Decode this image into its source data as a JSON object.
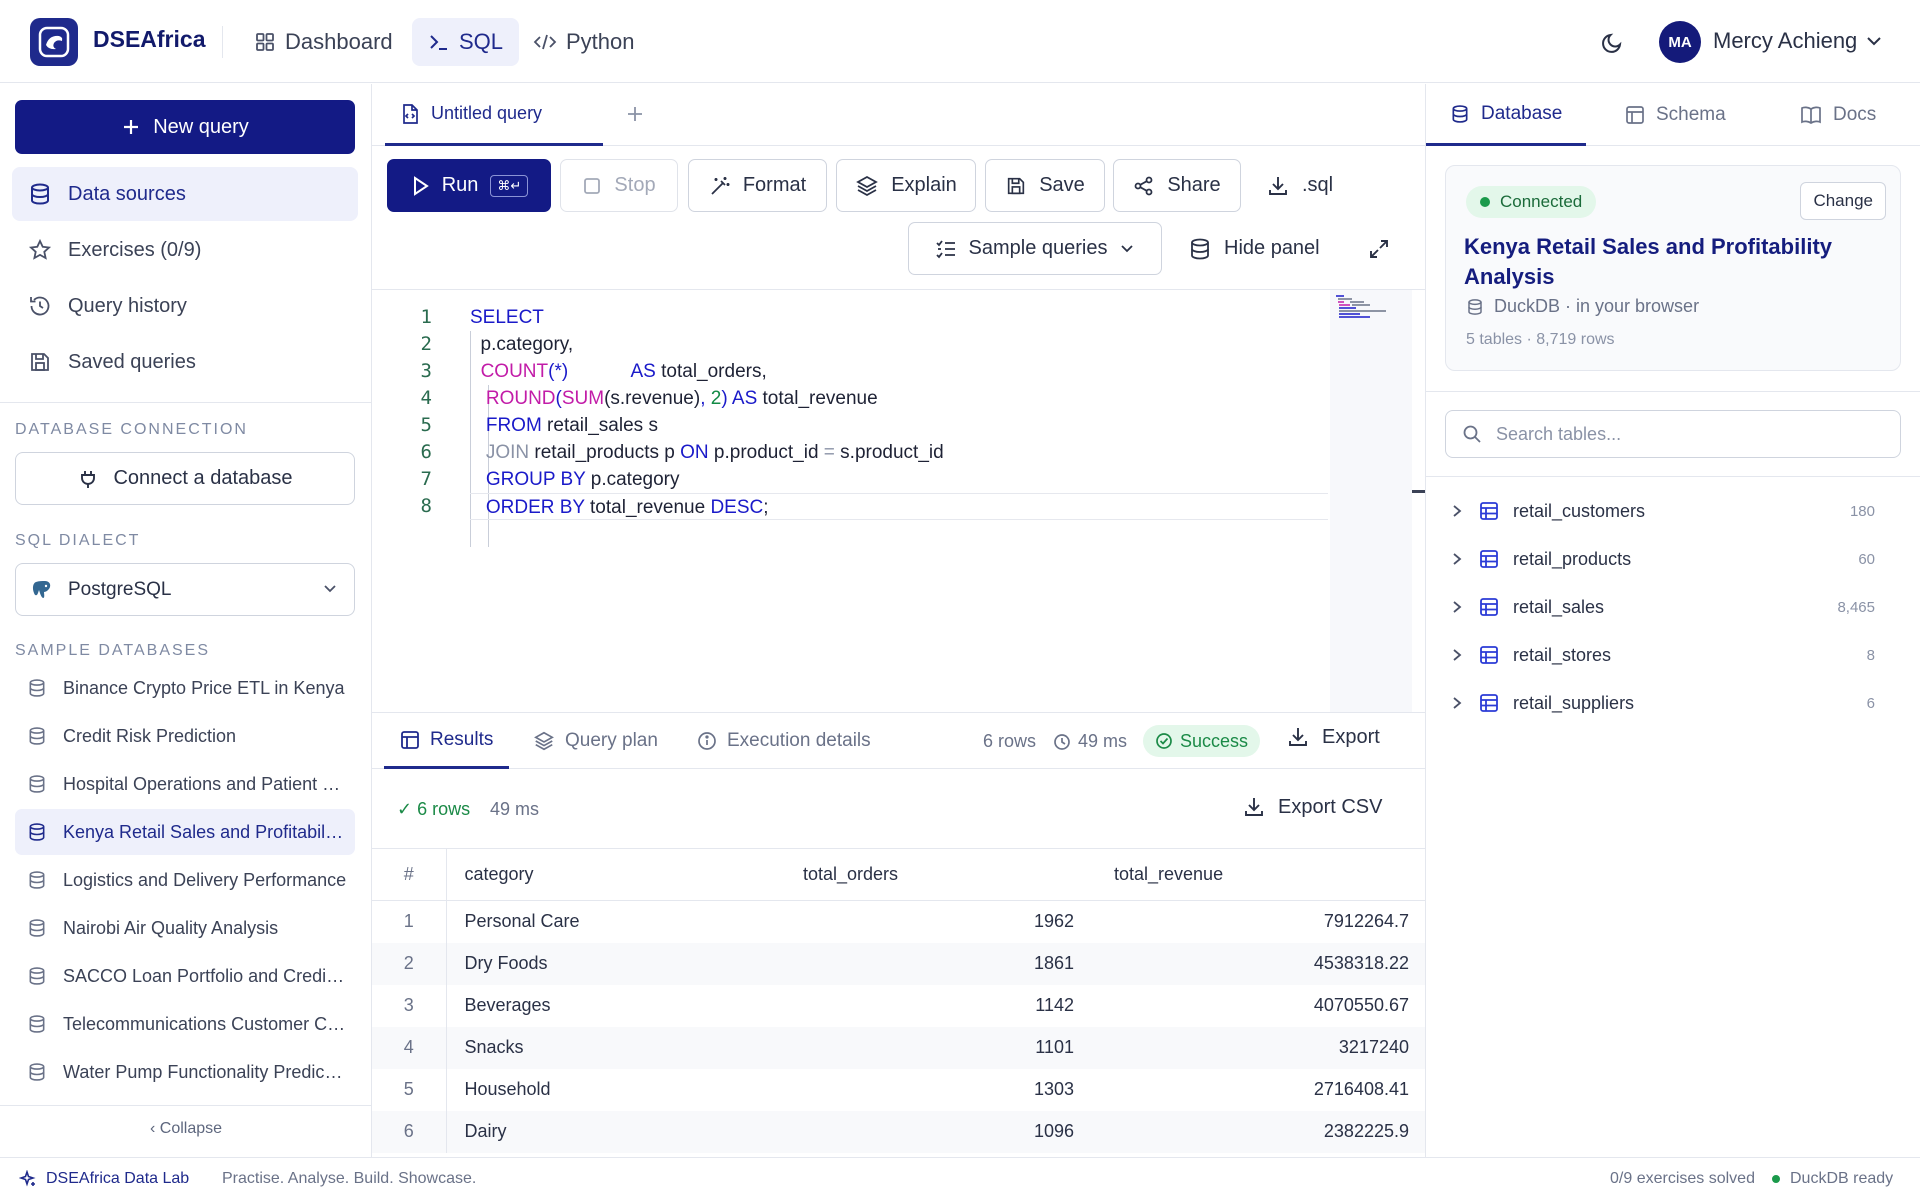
{
  "app": {
    "brand": "DSEAfrica",
    "nav": [
      {
        "label": "Dashboard",
        "icon": "grid-icon"
      },
      {
        "label": "SQL",
        "icon": "terminal-icon",
        "active": true
      },
      {
        "label": "Python",
        "icon": "code-icon"
      }
    ],
    "user": {
      "initials": "MA",
      "name": "Mercy Achieng"
    }
  },
  "sidebar": {
    "new_query": "New query",
    "items": [
      {
        "label": "Data sources",
        "icon": "database-icon",
        "active": true
      },
      {
        "label": "Exercises (0/9)",
        "icon": "star-icon"
      },
      {
        "label": "Query history",
        "icon": "history-icon"
      },
      {
        "label": "Saved queries",
        "icon": "save-icon"
      }
    ],
    "db_connection_label": "DATABASE CONNECTION",
    "connect_label": "Connect a database",
    "dialect_label": "SQL DIALECT",
    "dialect_value": "PostgreSQL",
    "sample_label": "SAMPLE DATABASES",
    "samples": [
      "Binance Crypto Price ETL in Kenya",
      "Credit Risk Prediction",
      "Hospital Operations and Patient Outcomes",
      "Kenya Retail Sales and Profitability Analysis",
      "Logistics and Delivery Performance",
      "Nairobi Air Quality Analysis",
      "SACCO Loan Portfolio and Credit Risk",
      "Telecommunications Customer Churn",
      "Water Pump Functionality Prediction"
    ],
    "active_sample": 3,
    "collapse": "‹ Collapse"
  },
  "editor": {
    "tab_label": "Untitled query",
    "toolbar": {
      "run": "Run",
      "run_kbd": "⌘↵",
      "stop": "Stop",
      "format": "Format",
      "explain": "Explain",
      "save": "Save",
      "share": "Share",
      "download": ".sql",
      "sample_queries": "Sample queries",
      "hide_panel": "Hide panel"
    },
    "line_numbers": [
      "1",
      "2",
      "3",
      "4",
      "5",
      "6",
      "7",
      "8"
    ]
  },
  "results": {
    "tabs": [
      "Results",
      "Query plan",
      "Execution details"
    ],
    "row_count": "6 rows",
    "time": "49 ms",
    "status": "Success",
    "export": "Export",
    "ok_rows": "✓ 6 rows",
    "ok_time": "49 ms",
    "export_csv": "Export CSV",
    "columns": [
      "#",
      "category",
      "total_orders",
      "total_revenue"
    ],
    "rows": [
      {
        "idx": "1",
        "category": "Personal Care",
        "total_orders": "1962",
        "total_revenue": "7912264.7"
      },
      {
        "idx": "2",
        "category": "Dry Foods",
        "total_orders": "1861",
        "total_revenue": "4538318.22"
      },
      {
        "idx": "3",
        "category": "Beverages",
        "total_orders": "1142",
        "total_revenue": "4070550.67"
      },
      {
        "idx": "4",
        "category": "Snacks",
        "total_orders": "1101",
        "total_revenue": "3217240"
      },
      {
        "idx": "5",
        "category": "Household",
        "total_orders": "1303",
        "total_revenue": "2716408.41"
      },
      {
        "idx": "6",
        "category": "Dairy",
        "total_orders": "1096",
        "total_revenue": "2382225.9"
      }
    ]
  },
  "panel": {
    "tabs": [
      "Database",
      "Schema",
      "Docs"
    ],
    "connected": "Connected",
    "change": "Change",
    "db_title": "Kenya Retail Sales and Profitability Analysis",
    "engine": "DuckDB · in your browser",
    "stats": "5 tables · 8,719 rows",
    "search_placeholder": "Search tables...",
    "tables": [
      {
        "name": "retail_customers",
        "count": "180"
      },
      {
        "name": "retail_products",
        "count": "60"
      },
      {
        "name": "retail_sales",
        "count": "8,465"
      },
      {
        "name": "retail_stores",
        "count": "8"
      },
      {
        "name": "retail_suppliers",
        "count": "6"
      }
    ]
  },
  "status": {
    "brand": "DSEAfrica Data Lab",
    "tagline": "Practise. Analyse. Build. Showcase.",
    "exercises": "0/9 exercises solved",
    "engine": "DuckDB ready"
  },
  "colors": {
    "primary": "#131a85",
    "success": "#1b8a47",
    "keyword": "#1a1ac9",
    "function": "#c21ca8"
  }
}
